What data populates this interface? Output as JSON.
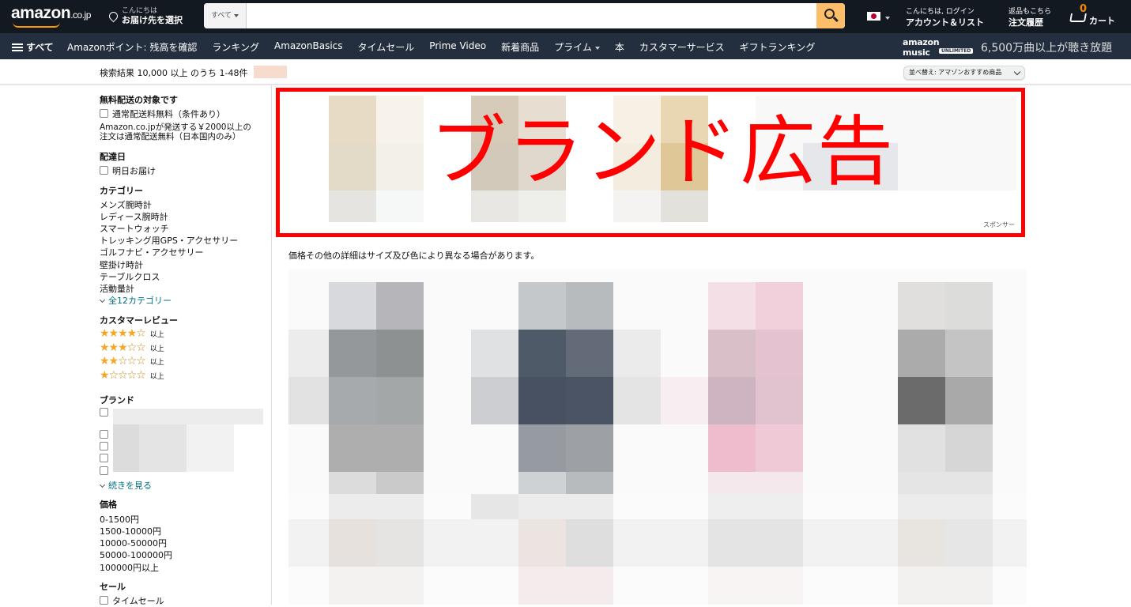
{
  "header": {
    "logo_text": "amazon",
    "logo_suffix": ".co.jp",
    "deliver_line1": "こんにちは",
    "deliver_line2": "お届け先を選択",
    "search_category": "すべて",
    "search_value": "",
    "account_line1": "こんにちは, ログイン",
    "account_line2": "アカウント＆リスト",
    "orders_line1": "返品もこちら",
    "orders_line2": "注文履歴",
    "cart_count": "0",
    "cart_label": "カート"
  },
  "nav": {
    "all_label": "すべて",
    "links": [
      "Amazonポイント: 残高を確認",
      "ランキング",
      "AmazonBasics",
      "タイムセール",
      "Prime Video",
      "新着商品",
      "プライム",
      "本",
      "カスタマーサービス",
      "ギフトランキング"
    ],
    "music_logo": "amazon music",
    "music_badge": "UNLIMITED",
    "music_tagline": "6,500万曲以上が聴き放題"
  },
  "results": {
    "summary": "検索結果 10,000 以上 のうち 1-48件",
    "sort_label": "並べ替え: アマゾンおすすめ商品"
  },
  "sidebar": {
    "shipping_heading": "無料配送の対象です",
    "shipping_option": "通常配送料無料（条件あり）",
    "shipping_note_1": "Amazon.co.jpが発送する￥2000以上の",
    "shipping_note_2": "注文は通常配送無料（日本国内のみ）",
    "delivery_heading": "配達日",
    "delivery_option": "明日お届け",
    "category_heading": "カテゴリー",
    "categories": [
      "メンズ腕時計",
      "レディース腕時計",
      "スマートウォッチ",
      "トレッキング用GPS・アクセサリー",
      "ゴルフナビ・アクセサリー",
      "壁掛け時計",
      "テーブルクロス",
      "活動量計"
    ],
    "all_categories": "全12カテゴリー",
    "review_heading": "カスタマーレビュー",
    "review_and_up": "以上",
    "review_levels": [
      4,
      3,
      2,
      1
    ],
    "brand_heading": "ブランド",
    "see_more": "続きを見る",
    "price_heading": "価格",
    "prices": [
      "0-1500円",
      "1500-10000円",
      "10000-50000円",
      "50000-100000円",
      "100000円以上"
    ],
    "sale_heading": "セール",
    "sale_option": "タイムセール"
  },
  "ad": {
    "label": "ブランド広告",
    "sponsor": "スポンサー"
  },
  "main": {
    "price_note": "価格その他の詳細はサイズ及び色により異なる場合があります。"
  }
}
